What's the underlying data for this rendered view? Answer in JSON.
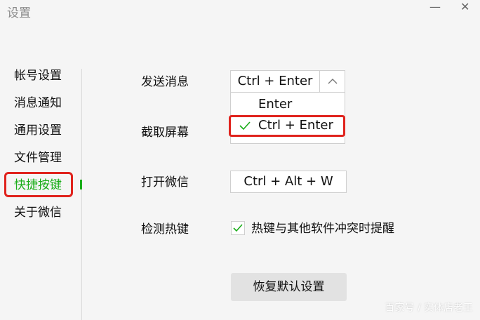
{
  "window": {
    "title": "设置",
    "minimize_label": "—",
    "close_label": "✕"
  },
  "nav": {
    "items": [
      {
        "label": "帐号设置"
      },
      {
        "label": "消息通知"
      },
      {
        "label": "通用设置"
      },
      {
        "label": "文件管理"
      },
      {
        "label": "快捷按键",
        "active": true
      },
      {
        "label": "关于微信"
      }
    ],
    "accent_color": "#1aad19",
    "highlight_color": "#e0231d"
  },
  "shortcuts": {
    "send_message": {
      "label": "发送消息",
      "value": "Ctrl + Enter",
      "options": [
        {
          "label": "Enter",
          "selected": false
        },
        {
          "label": "Ctrl + Enter",
          "selected": true
        }
      ],
      "arrow_icon": "chevron-up-icon"
    },
    "screenshot": {
      "label": "截取屏幕"
    },
    "open_wechat": {
      "label": "打开微信",
      "value": "Ctrl + Alt + W"
    },
    "detect_hotkey": {
      "label": "检测热键",
      "checkbox_checked": true,
      "checkbox_label": "热键与其他软件冲突时提醒"
    }
  },
  "restore_button": {
    "label": "恢复默认设置"
  },
  "watermark": {
    "text": "百家号 / 实体店老王"
  }
}
